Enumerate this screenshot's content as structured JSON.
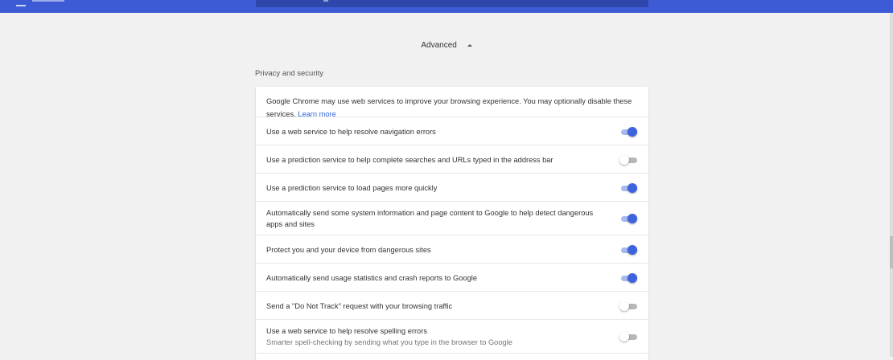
{
  "header": {
    "accent_color": "#3e5bd6",
    "menu_icon": "hamburger-menu-icon"
  },
  "advanced": {
    "label": "Advanced",
    "icon": "chevron-up-icon"
  },
  "section": {
    "title": "Privacy and security"
  },
  "intro": {
    "text": "Google Chrome may use web services to improve your browsing experience. You may optionally disable these services.",
    "link": "Learn more"
  },
  "settings": [
    {
      "label": "Use a web service to help resolve navigation errors",
      "sub": "",
      "enabled": true
    },
    {
      "label": "Use a prediction service to help complete searches and URLs typed in the address bar",
      "sub": "",
      "enabled": false
    },
    {
      "label": "Use a prediction service to load pages more quickly",
      "sub": "",
      "enabled": true
    },
    {
      "label": "Automatically send some system information and page content to Google to help detect dangerous apps and sites",
      "sub": "",
      "enabled": true
    },
    {
      "label": "Protect you and your device from dangerous sites",
      "sub": "",
      "enabled": true
    },
    {
      "label": "Automatically send usage statistics and crash reports to Google",
      "sub": "",
      "enabled": true
    },
    {
      "label": "Send a \"Do Not Track\" request with your browsing traffic",
      "sub": "",
      "enabled": false
    },
    {
      "label": "Use a web service to help resolve spelling errors",
      "sub": "Smarter spell-checking by sending what you type in the browser to Google",
      "enabled": false
    }
  ]
}
